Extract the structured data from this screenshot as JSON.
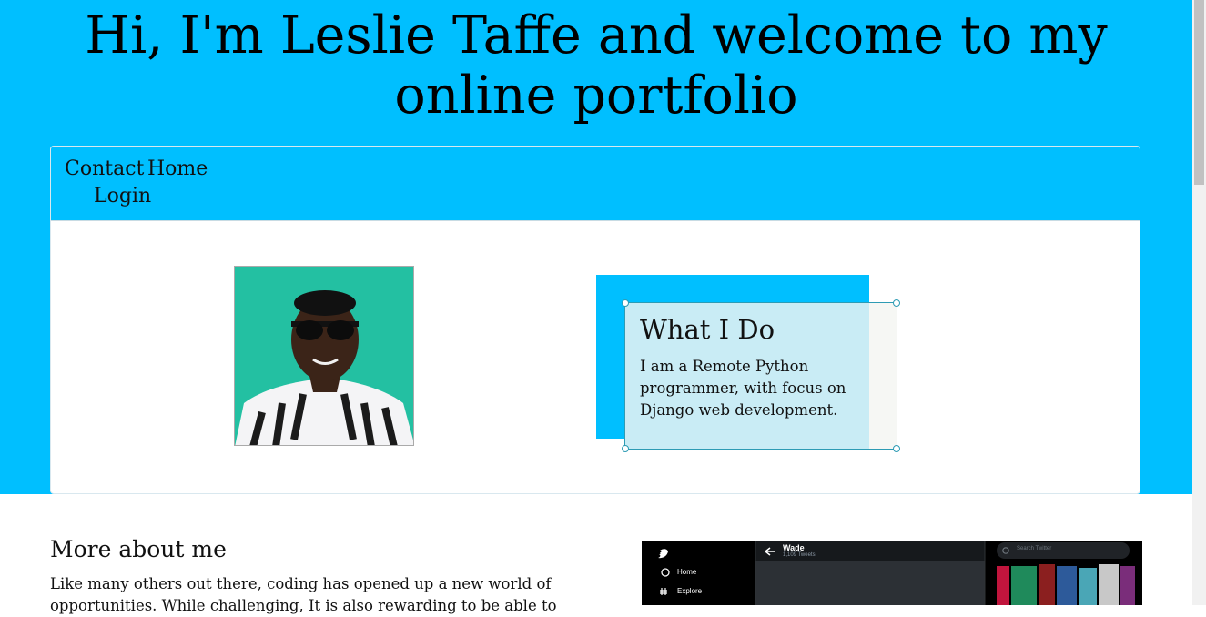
{
  "hero": {
    "title_line1": "Hi, I'm Leslie Taffe and welcome to my",
    "title_line2": "online portfolio"
  },
  "nav": {
    "contact": "Contact",
    "home": "Home",
    "login": "Login"
  },
  "info": {
    "title": "What I Do",
    "text": "I am a Remote Python programmer, with focus on Django web development."
  },
  "about": {
    "title": "More about me",
    "text": "Like many others out there, coding has opened up a new world of opportunities. While challenging, It is also rewarding to be able to"
  },
  "twitter_preview": {
    "profile_name": "Wade",
    "tweets_count": "1,109 Tweets",
    "menu_home": "Home",
    "menu_explore": "Explore",
    "search_placeholder": "Search Twitter"
  },
  "colors": {
    "accent": "#00bfff",
    "box_fill": "#c9ecf5",
    "box_border": "#2d9bb4"
  }
}
